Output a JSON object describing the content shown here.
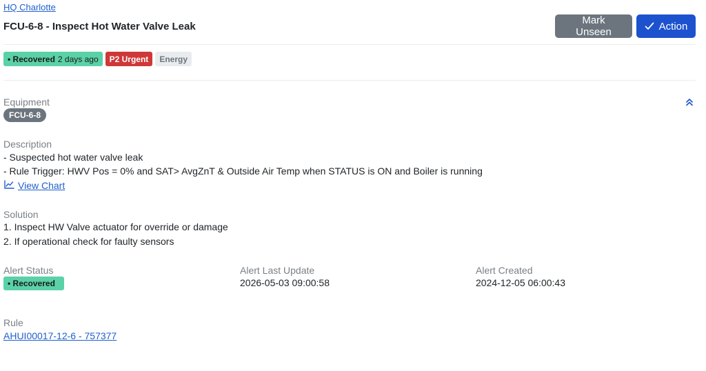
{
  "header": {
    "site_link": "HQ Charlotte",
    "title": "FCU-6-8 - Inspect Hot Water Valve Leak",
    "mark_unseen_label": "Mark Unseen",
    "action_label": "Action"
  },
  "badges": {
    "recovered_label": "• Recovered",
    "recovered_time": "2 days ago",
    "priority": "P2 Urgent",
    "category": "Energy"
  },
  "equipment": {
    "label": "Equipment",
    "value": "FCU-6-8"
  },
  "description": {
    "label": "Description",
    "lines": [
      "- Suspected hot water valve leak",
      "- Rule Trigger: HWV Pos = 0% and SAT> AvgZnT & Outside Air Temp when STATUS is ON and Boiler is running"
    ],
    "view_chart_label": "View Chart"
  },
  "solution": {
    "label": "Solution",
    "lines": [
      "1. Inspect HW Valve actuator for override or damage",
      "2. If operational check for faulty sensors"
    ]
  },
  "status": {
    "alert_status_label": "Alert Status",
    "alert_status_value": "• Recovered",
    "last_update_label": "Alert Last Update",
    "last_update_value": "2026-05-03 09:00:58",
    "created_label": "Alert Created",
    "created_value": "2024-12-05 06:00:43"
  },
  "rule": {
    "label": "Rule",
    "value": "AHUI00017-12-6 - 757377"
  },
  "colors": {
    "primary": "#1d52cf",
    "secondary": "#6c757d",
    "recovered": "#5bd1a8",
    "urgent": "#cf3838",
    "link": "#1f5fcf"
  },
  "icons": {
    "action_icon": "check-icon",
    "collapse_icon": "chevron-double-up-icon",
    "chart_icon": "line-chart-icon"
  }
}
